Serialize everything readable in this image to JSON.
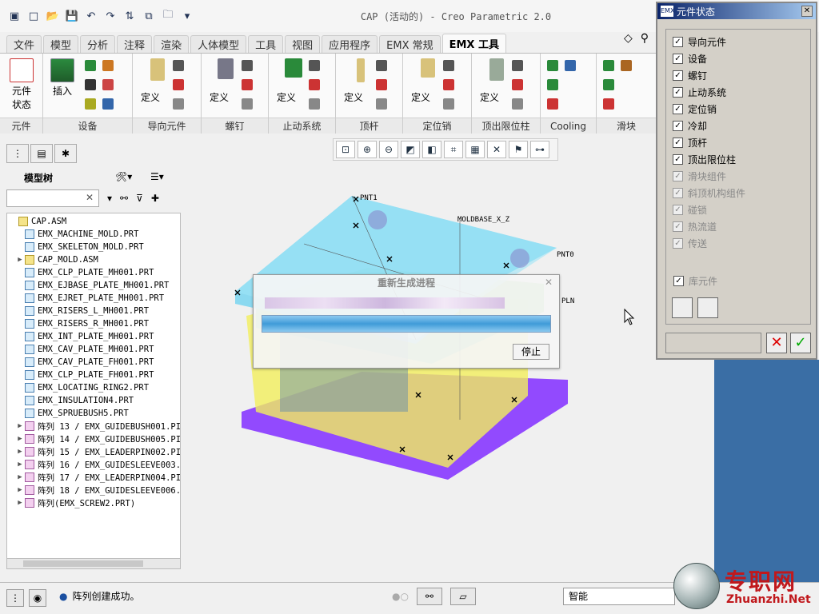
{
  "app_title": "CAP (活动的) - Creo Parametric 2.0",
  "tabs": [
    "文件",
    "模型",
    "分析",
    "注释",
    "渲染",
    "人体模型",
    "工具",
    "视图",
    "应用程序",
    "EMX 常规",
    "EMX 工具"
  ],
  "active_tab": "EMX 工具",
  "ribbon_groups": [
    {
      "label": "元件",
      "buttons": [
        "元件\n状态"
      ]
    },
    {
      "label": "设备",
      "buttons": [
        "插入"
      ]
    },
    {
      "label": "导向元件",
      "buttons": [
        "定义"
      ]
    },
    {
      "label": "螺钉",
      "buttons": [
        "定义"
      ]
    },
    {
      "label": "止动系统",
      "buttons": [
        "定义"
      ]
    },
    {
      "label": "顶杆",
      "buttons": [
        "定义"
      ]
    },
    {
      "label": "定位销",
      "buttons": [
        "定义"
      ]
    },
    {
      "label": "顶出限位柱",
      "buttons": [
        "定义"
      ]
    },
    {
      "label": "Cooling",
      "buttons": []
    },
    {
      "label": "滑块",
      "buttons": []
    }
  ],
  "ribbon_button_labels": {
    "component_status": [
      "元件",
      "状态"
    ],
    "insert": "插入",
    "define": "定义"
  },
  "model_tree": {
    "header": "模型树",
    "search_placeholder": "",
    "items": [
      {
        "label": "CAP.ASM",
        "type": "asm",
        "indent": 0,
        "expand": false
      },
      {
        "label": "EMX_MACHINE_MOLD.PRT",
        "type": "prt",
        "indent": 1,
        "expand": false
      },
      {
        "label": "EMX_SKELETON_MOLD.PRT",
        "type": "prt",
        "indent": 1,
        "expand": false
      },
      {
        "label": "CAP_MOLD.ASM",
        "type": "asm",
        "indent": 1,
        "expand": true
      },
      {
        "label": "EMX_CLP_PLATE_MH001.PRT",
        "type": "prt",
        "indent": 1,
        "expand": false
      },
      {
        "label": "EMX_EJBASE_PLATE_MH001.PRT",
        "type": "prt",
        "indent": 1,
        "expand": false
      },
      {
        "label": "EMX_EJRET_PLATE_MH001.PRT",
        "type": "prt",
        "indent": 1,
        "expand": false
      },
      {
        "label": "EMX_RISERS_L_MH001.PRT",
        "type": "prt",
        "indent": 1,
        "expand": false
      },
      {
        "label": "EMX_RISERS_R_MH001.PRT",
        "type": "prt",
        "indent": 1,
        "expand": false
      },
      {
        "label": "EMX_INT_PLATE_MH001.PRT",
        "type": "prt",
        "indent": 1,
        "expand": false
      },
      {
        "label": "EMX_CAV_PLATE_MH001.PRT",
        "type": "prt",
        "indent": 1,
        "expand": false
      },
      {
        "label": "EMX_CAV_PLATE_FH001.PRT",
        "type": "prt",
        "indent": 1,
        "expand": false
      },
      {
        "label": "EMX_CLP_PLATE_FH001.PRT",
        "type": "prt",
        "indent": 1,
        "expand": false
      },
      {
        "label": "EMX_LOCATING_RING2.PRT",
        "type": "prt",
        "indent": 1,
        "expand": false
      },
      {
        "label": "EMX_INSULATION4.PRT",
        "type": "prt",
        "indent": 1,
        "expand": false
      },
      {
        "label": "EMX_SPRUEBUSH5.PRT",
        "type": "prt",
        "indent": 1,
        "expand": false
      },
      {
        "label": "阵列 13 / EMX_GUIDEBUSH001.PI",
        "type": "pat",
        "indent": 1,
        "expand": true
      },
      {
        "label": "阵列 14 / EMX_GUIDEBUSH005.PI",
        "type": "pat",
        "indent": 1,
        "expand": true
      },
      {
        "label": "阵列 15 / EMX_LEADERPIN002.PI",
        "type": "pat",
        "indent": 1,
        "expand": true
      },
      {
        "label": "阵列 16 / EMX_GUIDESLEEVE003.",
        "type": "pat",
        "indent": 1,
        "expand": true
      },
      {
        "label": "阵列 17 / EMX_LEADERPIN004.PI",
        "type": "pat",
        "indent": 1,
        "expand": true
      },
      {
        "label": "阵列 18 / EMX_GUIDESLEEVE006.",
        "type": "pat",
        "indent": 1,
        "expand": true
      },
      {
        "label": "阵列(EMX_SCREW2.PRT)",
        "type": "pat",
        "indent": 1,
        "expand": true
      }
    ]
  },
  "viewport_labels": {
    "moldbase": "MOLDBASE_X_Z",
    "pnt1": "PNT1",
    "pnt0": "PNT0",
    "pln": "PLN"
  },
  "regen_dialog": {
    "title": "重新生成进程",
    "progress": 1.0,
    "stop_label": "停止"
  },
  "component_panel": {
    "title": "元件状态",
    "icon_text": "EMX",
    "items": [
      {
        "label": "导向元件",
        "checked": true,
        "enabled": true
      },
      {
        "label": "设备",
        "checked": true,
        "enabled": true
      },
      {
        "label": "螺钉",
        "checked": true,
        "enabled": true
      },
      {
        "label": "止动系统",
        "checked": true,
        "enabled": true
      },
      {
        "label": "定位销",
        "checked": true,
        "enabled": true
      },
      {
        "label": "冷却",
        "checked": true,
        "enabled": true
      },
      {
        "label": "顶杆",
        "checked": true,
        "enabled": true
      },
      {
        "label": "顶出限位柱",
        "checked": true,
        "enabled": true
      },
      {
        "label": "滑块组件",
        "checked": true,
        "enabled": false
      },
      {
        "label": "斜顶机构组件",
        "checked": true,
        "enabled": false
      },
      {
        "label": "碰锁",
        "checked": true,
        "enabled": false
      },
      {
        "label": "热流道",
        "checked": true,
        "enabled": false
      },
      {
        "label": "传送",
        "checked": true,
        "enabled": false
      }
    ],
    "library_label": "库元件",
    "library_checked": true
  },
  "status_bar": {
    "message": "阵列创建成功。",
    "filter": "智能"
  },
  "watermark": {
    "cn": "专职网",
    "en": "Zhuanzhi.Net"
  },
  "colors": {
    "accent_blue": "#1a4fa0",
    "mold_purple": "#8a3cff",
    "mold_cyan": "#7fd6f0",
    "mold_yellow": "#f3ef5c"
  }
}
